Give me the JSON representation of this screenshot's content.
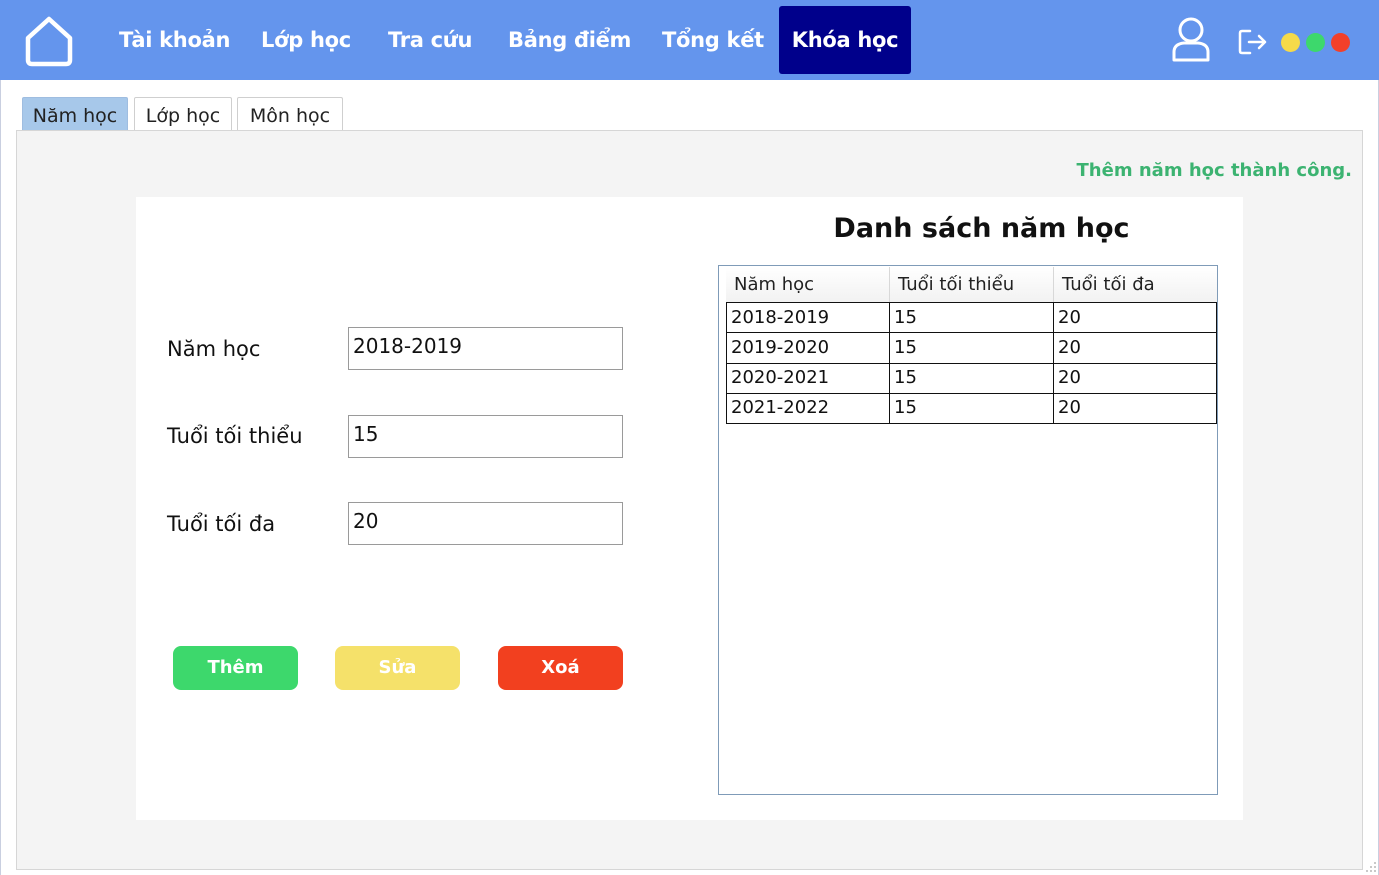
{
  "nav": {
    "items": [
      {
        "label": "Tài khoản"
      },
      {
        "label": "Lớp học"
      },
      {
        "label": "Tra cứu"
      },
      {
        "label": "Bảng điểm"
      },
      {
        "label": "Tổng kết"
      },
      {
        "label": "Khóa học"
      }
    ],
    "active_item": "Khóa học",
    "icons": {
      "home": "home-icon",
      "user": "user-icon",
      "logout": "logout-icon"
    },
    "window_dots": [
      {
        "name": "yellow",
        "color": "#F5DA4A"
      },
      {
        "name": "green",
        "color": "#3DD86C"
      },
      {
        "name": "red",
        "color": "#F2402A"
      }
    ],
    "bar_color": "#6495ED",
    "active_color": "#00008B"
  },
  "tabs": [
    {
      "label": "Năm học"
    },
    {
      "label": "Lớp học"
    },
    {
      "label": "Môn học"
    }
  ],
  "active_tab": "Năm học",
  "status_message": "Thêm năm học thành công.",
  "form": {
    "fields": [
      {
        "label": "Năm học",
        "value": "2018-2019"
      },
      {
        "label": "Tuổi tối thiểu",
        "value": "15"
      },
      {
        "label": "Tuổi tối đa",
        "value": "20"
      }
    ],
    "buttons": {
      "add": {
        "label": "Thêm",
        "color": "#3DD86C"
      },
      "edit": {
        "label": "Sửa",
        "color": "#F5E16A"
      },
      "delete": {
        "label": "Xoá",
        "color": "#F2401F"
      }
    }
  },
  "table": {
    "title": "Danh sách năm học",
    "columns": [
      "Năm học",
      "Tuổi tối thiểu",
      "Tuổi tối đa"
    ],
    "rows": [
      [
        "2018-2019",
        "15",
        "20"
      ],
      [
        "2019-2020",
        "15",
        "20"
      ],
      [
        "2020-2021",
        "15",
        "20"
      ],
      [
        "2021-2022",
        "15",
        "20"
      ]
    ]
  }
}
